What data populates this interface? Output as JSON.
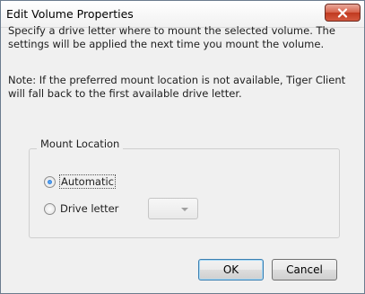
{
  "window": {
    "title": "Edit Volume Properties"
  },
  "body": {
    "paragraph1": "Specify a drive letter where to mount the selected volume. The settings will be applied the next time you mount the volume.",
    "paragraph2": "Note: If the preferred mount location is not available, Tiger Client will fall back to the first available drive letter."
  },
  "mount_location": {
    "label": "Mount Location",
    "options": [
      {
        "label": "Automatic",
        "checked": true
      },
      {
        "label": "Drive letter",
        "checked": false
      }
    ],
    "drive_letter_value": ""
  },
  "buttons": {
    "ok": "OK",
    "cancel": "Cancel"
  },
  "colors": {
    "close_button": "#c8432a",
    "radio_selected": "#1a63c8",
    "default_button_border": "#3c7fb1"
  },
  "icons": {
    "close": "close-icon",
    "dropdown": "chevron-down-icon"
  }
}
